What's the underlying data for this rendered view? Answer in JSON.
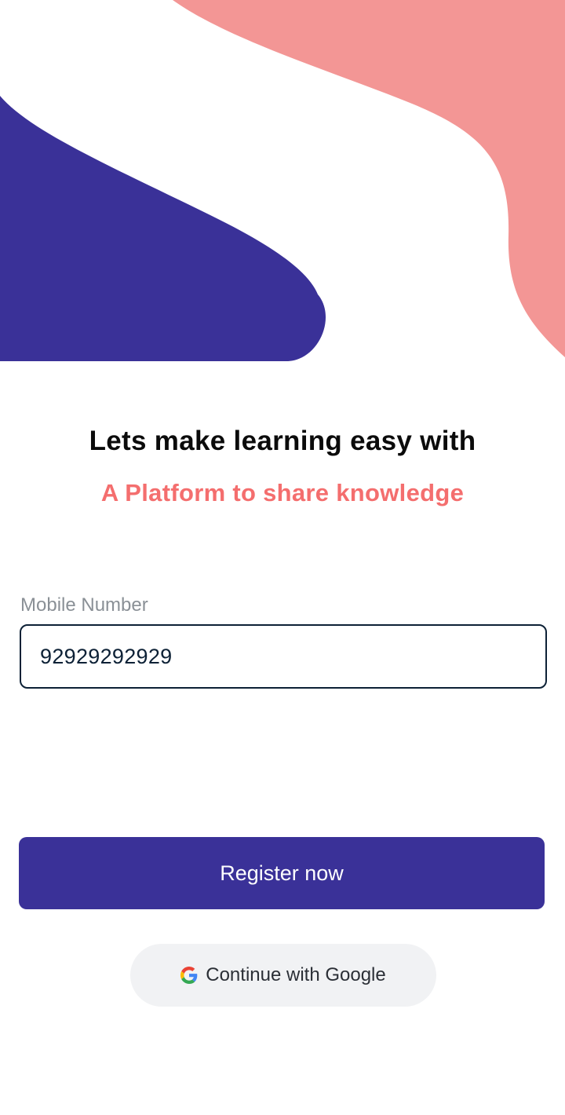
{
  "colors": {
    "primary": "#3a3198",
    "accent": "#f46e6e",
    "blob_pink": "#f39695",
    "blob_indigo": "#3a3198"
  },
  "hero": {
    "headline": "Lets make learning easy with",
    "subheadline": "A Platform to share knowledge"
  },
  "form": {
    "mobile_label": "Mobile Number",
    "mobile_value": "92929292929"
  },
  "actions": {
    "register_label": "Register now",
    "google_label": "Continue with Google",
    "google_icon": "google-icon"
  }
}
